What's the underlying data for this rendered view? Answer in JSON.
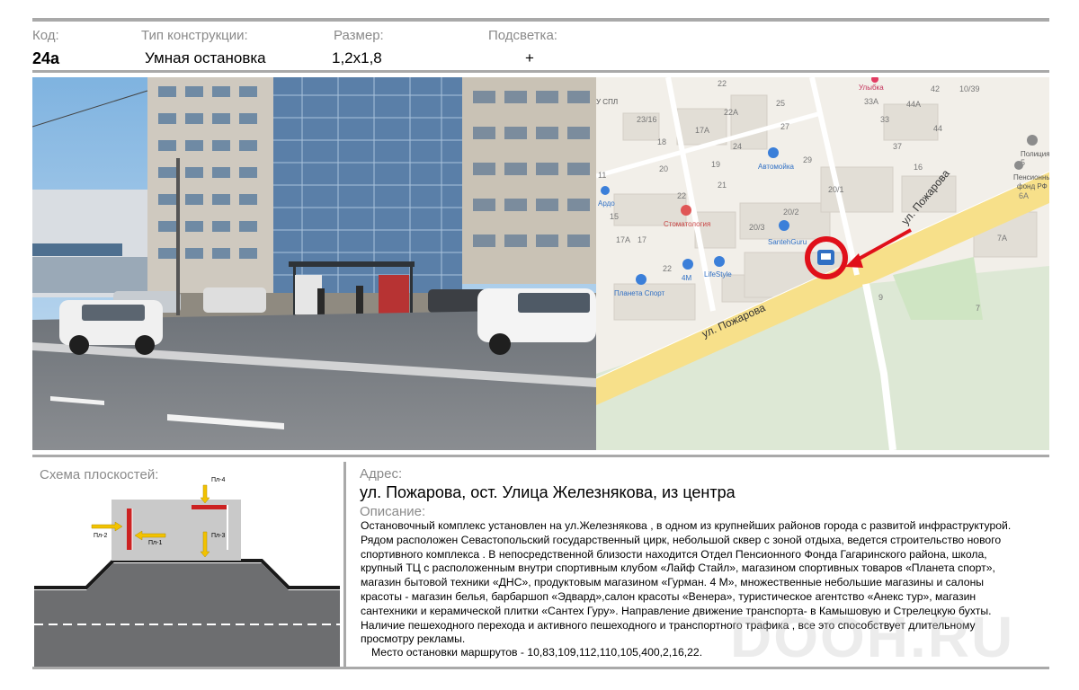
{
  "header": {
    "code_label": "Код:",
    "code_value": "24а",
    "type_label": "Тип конструкции:",
    "type_value": "Умная остановка",
    "size_label": "Размер:",
    "size_value": "1,2х1,8",
    "light_label": "Подсветка:",
    "light_value": "+"
  },
  "map": {
    "street_1": "ул. Пожарова",
    "street_2": "ул. Пожарова",
    "pois": {
      "ulybka": "Улыбка",
      "avtomoyka": "Автомойка",
      "stomatologiya": "Стоматология",
      "santehguru": "SantehGuru",
      "lifestyle": "LifeStyle",
      "shop_4m": "4М",
      "planeta_sport": "Планета Спорт",
      "ardo": "Ардо",
      "policiya": "Полиция",
      "pension_1": "Пенсионный",
      "pension_2": "фонд РФ",
      "uspl": "У СПЛ"
    },
    "house_numbers": [
      "22",
      "22А",
      "25",
      "27",
      "23/16",
      "18",
      "17А",
      "24",
      "29",
      "20",
      "19",
      "21",
      "20/1",
      "22",
      "20/3",
      "20/2",
      "15",
      "17А",
      "17",
      "22",
      "42",
      "44А",
      "10/39",
      "33А",
      "33",
      "44",
      "37",
      "16",
      "5",
      "7А",
      "9",
      "7",
      "11",
      "6А"
    ]
  },
  "schema": {
    "title": "Схема плоскостей:",
    "planes": [
      "Пл-1",
      "Пл-2",
      "Пл-3",
      "Пл-4"
    ]
  },
  "address": {
    "label": "Адрес:",
    "value": "ул. Пожарова, ост. Улица Железнякова, из центра"
  },
  "description": {
    "label": "Описание:",
    "lines": [
      "Остановочный комплекс установлен на ул.Железнякова , в одном из крупнейших районов города с развитой инфраструктурой.",
      "Рядом расположен  Севастопольский государственный цирк, небольшой сквер с зоной отдыха,  ведется строительство нового",
      "спортивного комплекса . В непосредственной близости находится  Отдел Пенсионного Фонда Гагаринского района, школа,",
      "крупный ТЦ  с расположенным внутри спортивным клубом «Лайф Стайл»,  магазином спортивных товаров «Планета спорт»,",
      "магазин  бытовой техники «ДНС», продуктовым магазином «Гурман. 4 М», множественные небольшие магазины и салоны",
      "красоты - магазин белья, барбаршоп «Эдвард»,салон красоты «Венера», туристическое агентство «Анекс тур», магазин",
      "сантехники и керамической плитки «Сантех Гуру». Направление движение транспорта-  в Камышовую и Стрелецкую бухты.",
      "Наличие пешеходного перехода и  активного пешеходного и транспортного трафика , все это способствует длительному",
      "просмотру рекламы."
    ],
    "routes": "Место остановки  маршрутов - 10,83,109,112,110,105,400,2,16,22."
  },
  "watermark": "DOOH.RU"
}
